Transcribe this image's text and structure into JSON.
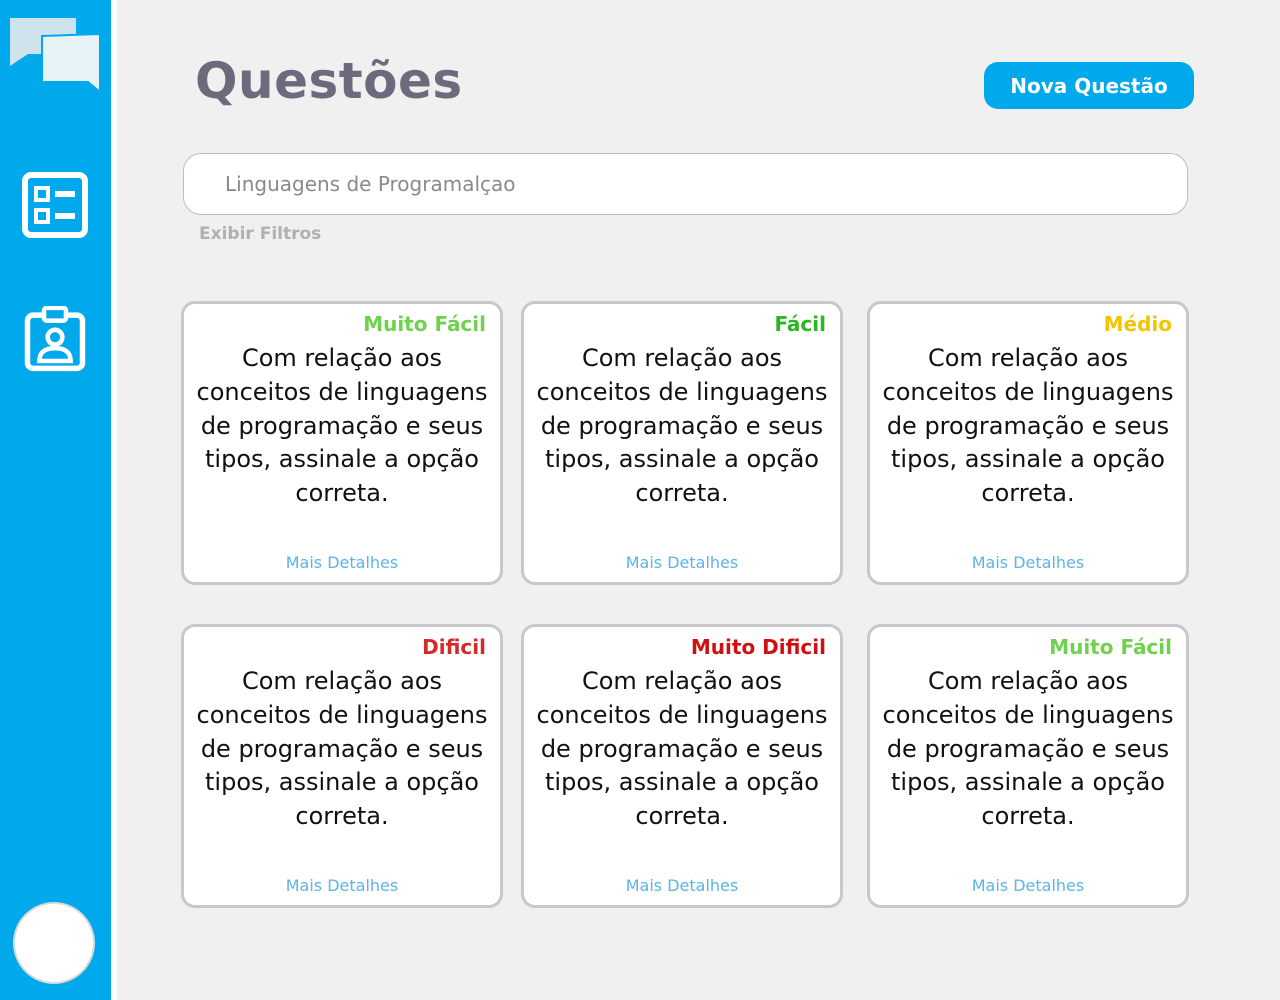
{
  "header": {
    "title": "Questões",
    "new_button_label": "Nova Questão"
  },
  "search": {
    "value": "Linguagens de Programalçao",
    "placeholder": ""
  },
  "filters_link": "Exibir Filtros",
  "sidebar": {
    "items": [
      {
        "name": "questions-list-icon"
      },
      {
        "name": "id-badge-icon"
      }
    ],
    "color": "#00a8ec"
  },
  "difficulty_colors": {
    "Muito Fácil": "#6fd14e",
    "Fácil": "#29b821",
    "Médio": "#f4c400",
    "Dificil": "#d42a2a",
    "Muito Dificil": "#d01010"
  },
  "cards": [
    {
      "difficulty": "Muito Fácil",
      "color": "#6fd14e",
      "question": "Com relação aos conceitos de linguagens de programação e seus tipos, assinale a opção correta.",
      "details_label": "Mais Detalhes"
    },
    {
      "difficulty": "Fácil",
      "color": "#29b821",
      "question": "Com relação aos conceitos de linguagens de programação e seus tipos, assinale a opção correta.",
      "details_label": "Mais Detalhes"
    },
    {
      "difficulty": "Médio",
      "color": "#f4c400",
      "question": "Com relação aos conceitos de linguagens de programação e seus tipos, assinale a opção correta.",
      "details_label": "Mais Detalhes"
    },
    {
      "difficulty": "Dificil",
      "color": "#d42a2a",
      "question": "Com relação aos conceitos de linguagens de programação e seus tipos, assinale a opção correta.",
      "details_label": "Mais Detalhes"
    },
    {
      "difficulty": "Muito Dificil",
      "color": "#d01010",
      "question": "Com relação aos conceitos de linguagens de programação e seus tipos, assinale a opção correta.",
      "details_label": "Mais Detalhes"
    },
    {
      "difficulty": "Muito Fácil",
      "color": "#6fd14e",
      "question": "Com relação aos conceitos de linguagens de programação e seus tipos, assinale a opção correta.",
      "details_label": "Mais Detalhes"
    }
  ]
}
